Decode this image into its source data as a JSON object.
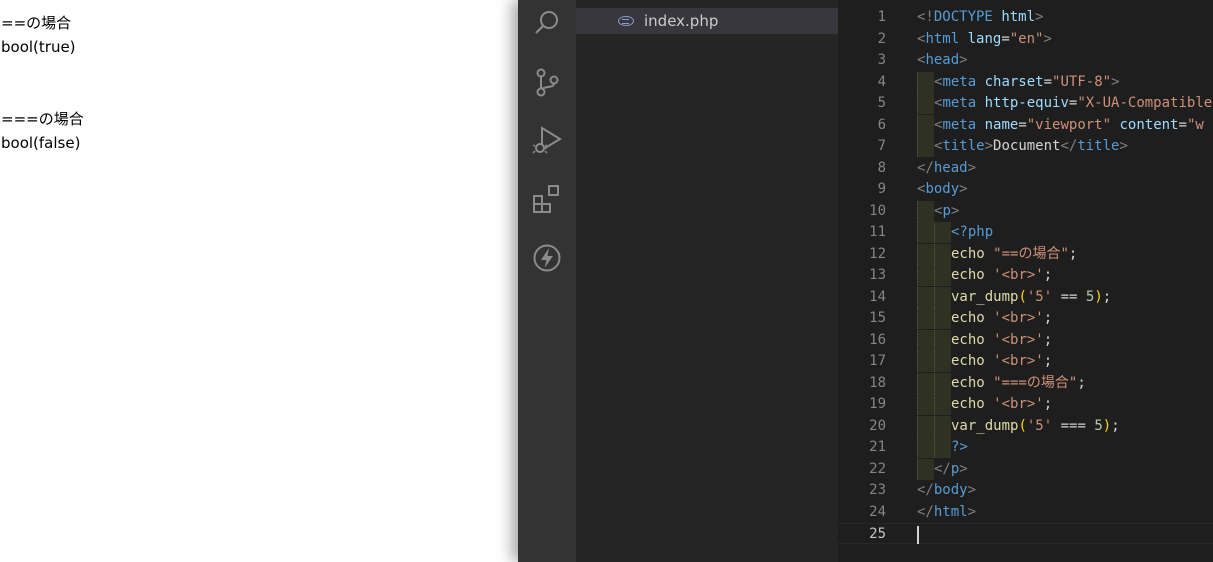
{
  "browser_output": {
    "lines": [
      "==の場合",
      "bool(true)",
      "",
      "",
      "===の場合",
      "bool(false)"
    ]
  },
  "explorer": {
    "file_name": "index.php"
  },
  "activity_bar": {
    "icons": [
      "search-icon",
      "source-control-icon",
      "run-debug-icon",
      "extensions-icon",
      "lightning-icon"
    ]
  },
  "editor": {
    "line_numbers": [
      "1",
      "2",
      "3",
      "4",
      "5",
      "6",
      "7",
      "8",
      "9",
      "10",
      "11",
      "12",
      "13",
      "14",
      "15",
      "16",
      "17",
      "18",
      "19",
      "20",
      "21",
      "22",
      "23",
      "24",
      "25"
    ],
    "current_line": "25",
    "lines": [
      [
        [
          "t-punc",
          "<!"
        ],
        [
          "t-tag",
          "DOCTYPE"
        ],
        [
          "t-text",
          " "
        ],
        [
          "t-attr",
          "html"
        ],
        [
          "t-punc",
          ">"
        ]
      ],
      [
        [
          "t-punc",
          "<"
        ],
        [
          "t-tag",
          "html"
        ],
        [
          "t-text",
          " "
        ],
        [
          "t-attr",
          "lang"
        ],
        [
          "t-op",
          "="
        ],
        [
          "t-str",
          "\"en\""
        ],
        [
          "t-punc",
          ">"
        ]
      ],
      [
        [
          "t-punc",
          "<"
        ],
        [
          "t-tag",
          "head"
        ],
        [
          "t-punc",
          ">"
        ]
      ],
      [
        [
          "t-punc",
          "<"
        ],
        [
          "t-tag",
          "meta"
        ],
        [
          "t-text",
          " "
        ],
        [
          "t-attr",
          "charset"
        ],
        [
          "t-op",
          "="
        ],
        [
          "t-str",
          "\"UTF-8\""
        ],
        [
          "t-punc",
          ">"
        ]
      ],
      [
        [
          "t-punc",
          "<"
        ],
        [
          "t-tag",
          "meta"
        ],
        [
          "t-text",
          " "
        ],
        [
          "t-attr",
          "http-equiv"
        ],
        [
          "t-op",
          "="
        ],
        [
          "t-str",
          "\"X-UA-Compatible\""
        ]
      ],
      [
        [
          "t-punc",
          "<"
        ],
        [
          "t-tag",
          "meta"
        ],
        [
          "t-text",
          " "
        ],
        [
          "t-attr",
          "name"
        ],
        [
          "t-op",
          "="
        ],
        [
          "t-str",
          "\"viewport\""
        ],
        [
          "t-text",
          " "
        ],
        [
          "t-attr",
          "content"
        ],
        [
          "t-op",
          "="
        ],
        [
          "t-str",
          "\"w"
        ]
      ],
      [
        [
          "t-punc",
          "<"
        ],
        [
          "t-tag",
          "title"
        ],
        [
          "t-punc",
          ">"
        ],
        [
          "t-text",
          "Document"
        ],
        [
          "t-punc",
          "</"
        ],
        [
          "t-tag",
          "title"
        ],
        [
          "t-punc",
          ">"
        ]
      ],
      [
        [
          "t-punc",
          "</"
        ],
        [
          "t-tag",
          "head"
        ],
        [
          "t-punc",
          ">"
        ]
      ],
      [
        [
          "t-punc",
          "<"
        ],
        [
          "t-tag",
          "body"
        ],
        [
          "t-punc",
          ">"
        ]
      ],
      [
        [
          "t-punc",
          "<"
        ],
        [
          "t-tag",
          "p"
        ],
        [
          "t-punc",
          ">"
        ]
      ],
      [
        [
          "t-php",
          "<?php"
        ]
      ],
      [
        [
          "t-kw",
          "echo"
        ],
        [
          "t-text",
          " "
        ],
        [
          "t-str",
          "\"==の場合\""
        ],
        [
          "t-text",
          ";"
        ]
      ],
      [
        [
          "t-kw",
          "echo"
        ],
        [
          "t-text",
          " "
        ],
        [
          "t-str",
          "'<br>'"
        ],
        [
          "t-text",
          ";"
        ]
      ],
      [
        [
          "t-fn",
          "var_dump"
        ],
        [
          "t-paren",
          "("
        ],
        [
          "t-str",
          "'5'"
        ],
        [
          "t-text",
          " "
        ],
        [
          "t-op",
          "=="
        ],
        [
          "t-text",
          " "
        ],
        [
          "t-num",
          "5"
        ],
        [
          "t-paren",
          ")"
        ],
        [
          "t-text",
          ";"
        ]
      ],
      [
        [
          "t-kw",
          "echo"
        ],
        [
          "t-text",
          " "
        ],
        [
          "t-str",
          "'<br>'"
        ],
        [
          "t-text",
          ";"
        ]
      ],
      [
        [
          "t-kw",
          "echo"
        ],
        [
          "t-text",
          " "
        ],
        [
          "t-str",
          "'<br>'"
        ],
        [
          "t-text",
          ";"
        ]
      ],
      [
        [
          "t-kw",
          "echo"
        ],
        [
          "t-text",
          " "
        ],
        [
          "t-str",
          "'<br>'"
        ],
        [
          "t-text",
          ";"
        ]
      ],
      [
        [
          "t-kw",
          "echo"
        ],
        [
          "t-text",
          " "
        ],
        [
          "t-str",
          "\"===の場合\""
        ],
        [
          "t-text",
          ";"
        ]
      ],
      [
        [
          "t-kw",
          "echo"
        ],
        [
          "t-text",
          " "
        ],
        [
          "t-str",
          "'<br>'"
        ],
        [
          "t-text",
          ";"
        ]
      ],
      [
        [
          "t-fn",
          "var_dump"
        ],
        [
          "t-paren",
          "("
        ],
        [
          "t-str",
          "'5'"
        ],
        [
          "t-text",
          " "
        ],
        [
          "t-op",
          "==="
        ],
        [
          "t-text",
          " "
        ],
        [
          "t-num",
          "5"
        ],
        [
          "t-paren",
          ")"
        ],
        [
          "t-text",
          ";"
        ]
      ],
      [
        [
          "t-php",
          "?>"
        ]
      ],
      [
        [
          "t-punc",
          "</"
        ],
        [
          "t-tag",
          "p"
        ],
        [
          "t-punc",
          ">"
        ]
      ],
      [
        [
          "t-punc",
          "</"
        ],
        [
          "t-tag",
          "body"
        ],
        [
          "t-punc",
          ">"
        ]
      ],
      [
        [
          "t-punc",
          "</"
        ],
        [
          "t-tag",
          "html"
        ],
        [
          "t-punc",
          ">"
        ]
      ],
      []
    ],
    "indent_levels": [
      0,
      0,
      0,
      1,
      1,
      1,
      1,
      0,
      0,
      1,
      2,
      2,
      2,
      2,
      2,
      2,
      2,
      2,
      2,
      2,
      2,
      1,
      0,
      0,
      0
    ]
  },
  "colors": {
    "editor_bg": "#1e1e1e",
    "activity_bar_bg": "#333333",
    "explorer_bg": "#252526",
    "selected_file_bg": "#37373d"
  }
}
